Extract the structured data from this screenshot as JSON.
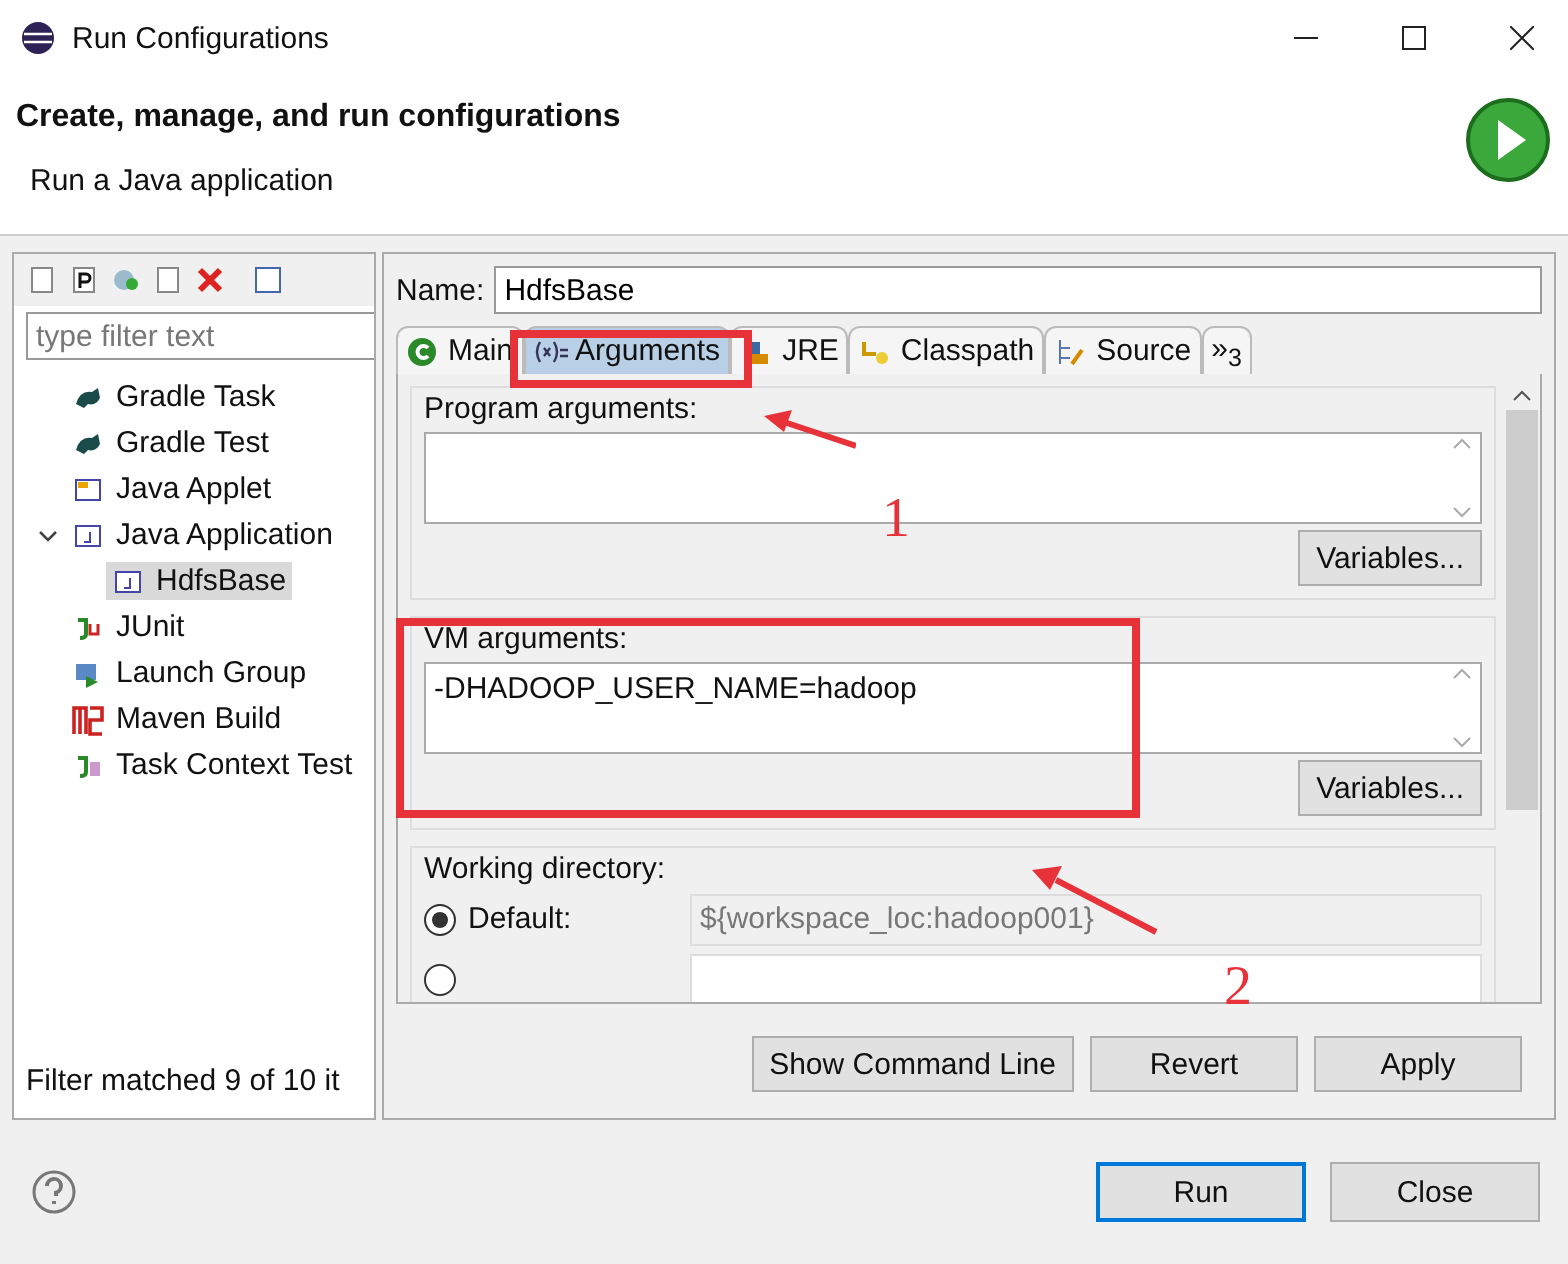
{
  "window": {
    "title": "Run Configurations"
  },
  "header": {
    "title": "Create, manage, and run configurations",
    "subtitle": "Run a Java application"
  },
  "filter": {
    "placeholder": "type filter text"
  },
  "tree": [
    {
      "label": "Gradle Task",
      "kind": "gradle",
      "selected": false
    },
    {
      "label": "Gradle Test",
      "kind": "gradle",
      "selected": false
    },
    {
      "label": "Java Applet",
      "kind": "applet",
      "selected": false
    },
    {
      "label": "Java Application",
      "kind": "java",
      "selected": false,
      "expanded": true,
      "children": [
        {
          "label": "HdfsBase",
          "kind": "java",
          "selected": true
        }
      ]
    },
    {
      "label": "JUnit",
      "kind": "junit",
      "selected": false
    },
    {
      "label": "Launch Group",
      "kind": "group",
      "selected": false
    },
    {
      "label": "Maven Build",
      "kind": "maven",
      "selected": false
    },
    {
      "label": "Task Context Test",
      "kind": "context",
      "selected": false
    }
  ],
  "filter_status": "Filter matched 9 of 10 it",
  "name": {
    "label": "Name:",
    "value": "HdfsBase"
  },
  "tabs": [
    {
      "label": "Main",
      "kind": "main",
      "selected": false
    },
    {
      "label": "Arguments",
      "kind": "args",
      "selected": true
    },
    {
      "label": "JRE",
      "kind": "jre",
      "selected": false
    },
    {
      "label": "Classpath",
      "kind": "classpath",
      "selected": false
    },
    {
      "label": "Source",
      "kind": "source",
      "selected": false
    },
    {
      "label": "»$_{3}$",
      "kind": "more",
      "selected": false
    }
  ],
  "program_arguments": {
    "label": "Program arguments:",
    "button": "Variables..."
  },
  "vm_arguments": {
    "label": "VM arguments:",
    "value": "-DHADOOP_USER_NAME=hadoop",
    "button": "Variables..."
  },
  "working_directory": {
    "label": "Working directory:",
    "default_label": "Default:",
    "default_value": "${workspace_loc:hadoop001}",
    "default_selected": true,
    "other_selected": false
  },
  "actions": [
    "Show Command Line",
    "Revert",
    "Apply"
  ],
  "dialog_buttons": [
    {
      "label": "Run",
      "default": true
    },
    {
      "label": "Close",
      "default": false
    }
  ],
  "annotations": [
    "1",
    "2"
  ]
}
